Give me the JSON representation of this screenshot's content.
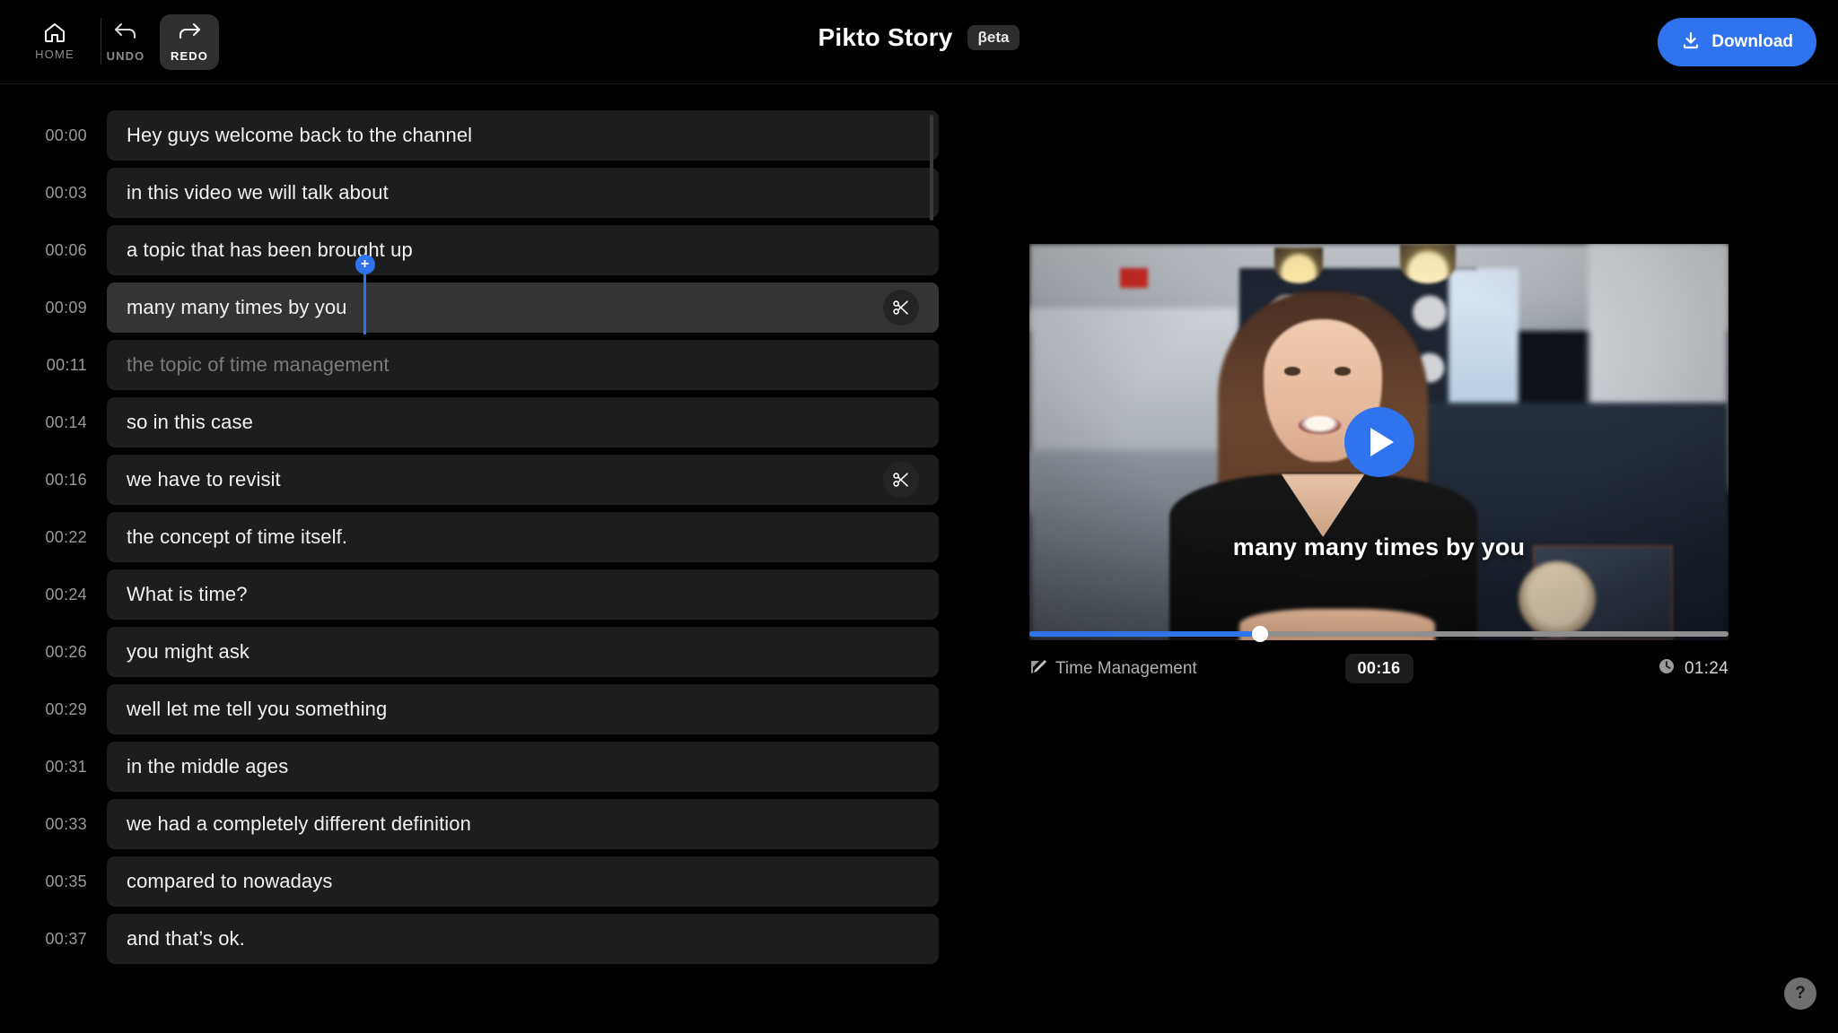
{
  "header": {
    "home_label": "HOME",
    "undo_label": "UNDO",
    "redo_label": "REDO",
    "title": "Pikto Story",
    "beta_badge": "βeta",
    "download_label": "Download",
    "accent_color": "#2f73ef"
  },
  "transcript": {
    "rows": [
      {
        "time": "00:00",
        "text": "Hey guys welcome back to the channel",
        "state": "normal",
        "cut": false
      },
      {
        "time": "00:03",
        "text": "in this video we will talk about",
        "state": "normal",
        "cut": false
      },
      {
        "time": "00:06",
        "text": "a topic that has been brought up",
        "state": "normal",
        "cut": false
      },
      {
        "time": "00:09",
        "text": "many many times by you",
        "state": "selected",
        "cut": true
      },
      {
        "time": "00:11",
        "text": "the topic of time management",
        "state": "dimmed",
        "cut": false
      },
      {
        "time": "00:14",
        "text": "so in this case",
        "state": "normal",
        "cut": false
      },
      {
        "time": "00:16",
        "text": "we have to revisit",
        "state": "normal",
        "cut": true
      },
      {
        "time": "00:22",
        "text": "the concept of time itself.",
        "state": "normal",
        "cut": false
      },
      {
        "time": "00:24",
        "text": "What is time?",
        "state": "normal",
        "cut": false
      },
      {
        "time": "00:26",
        "text": "you might ask",
        "state": "normal",
        "cut": false
      },
      {
        "time": "00:29",
        "text": "well let me tell you something",
        "state": "normal",
        "cut": false
      },
      {
        "time": "00:31",
        "text": "in the middle ages",
        "state": "normal",
        "cut": false
      },
      {
        "time": "00:33",
        "text": "we had a completely different definition",
        "state": "normal",
        "cut": false
      },
      {
        "time": "00:35",
        "text": "compared to nowadays",
        "state": "normal",
        "cut": false
      },
      {
        "time": "00:37",
        "text": "and that’s ok.",
        "state": "normal",
        "cut": false
      }
    ],
    "split_marker_label": "+",
    "cut_icon": "scissors-icon"
  },
  "player": {
    "caption": "many many times by you",
    "project_name": "Time Management",
    "current_time": "00:16",
    "duration": "01:24",
    "progress_percent": 33,
    "play_icon": "play-icon",
    "edit_icon": "edit-icon",
    "clock_icon": "clock-icon"
  },
  "help": {
    "label": "?"
  }
}
